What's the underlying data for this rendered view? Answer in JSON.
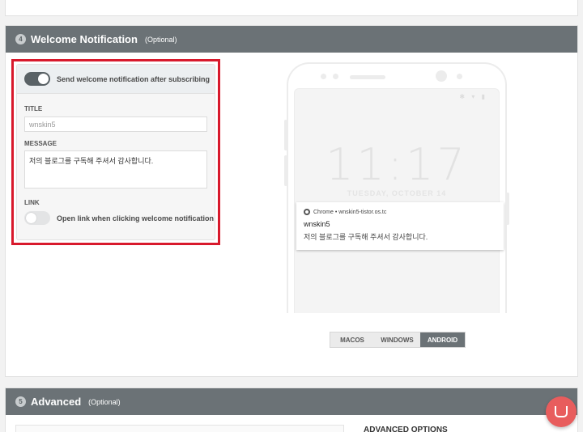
{
  "section4": {
    "step": "4",
    "title": "Welcome Notification",
    "optional": "(Optional)",
    "send_welcome_label": "Send welcome notification after subscribing",
    "title_label": "TITLE",
    "title_value": "wnskin5",
    "message_label": "MESSAGE",
    "message_value": "저의 블로그를 구독해 주셔서 감사합니다.",
    "link_label": "LINK",
    "open_link_label": "Open link when clicking welcome notification",
    "send_welcome_enabled": true,
    "open_link_enabled": false
  },
  "preview": {
    "clock": "11:17",
    "date": "TUESDAY, OCTOBER 14",
    "notification": {
      "source": "Chrome • wnskin5-tistor.os.tc",
      "title": "wnskin5",
      "body": "저의 블로그를 구독해 주셔서 감사합니다."
    },
    "platforms": [
      "MACOS",
      "WINDOWS",
      "ANDROID"
    ],
    "active_platform": "ANDROID"
  },
  "section5": {
    "step": "5",
    "title": "Advanced",
    "optional": "(Optional)",
    "advanced_options_label": "ADVANCED OPTIONS"
  },
  "icons": {
    "chat": "chat-bubble-icon",
    "chrome": "chrome-icon"
  },
  "colors": {
    "header": "#6b7276",
    "highlight": "#d8192c",
    "chat": "#e85d5d"
  }
}
